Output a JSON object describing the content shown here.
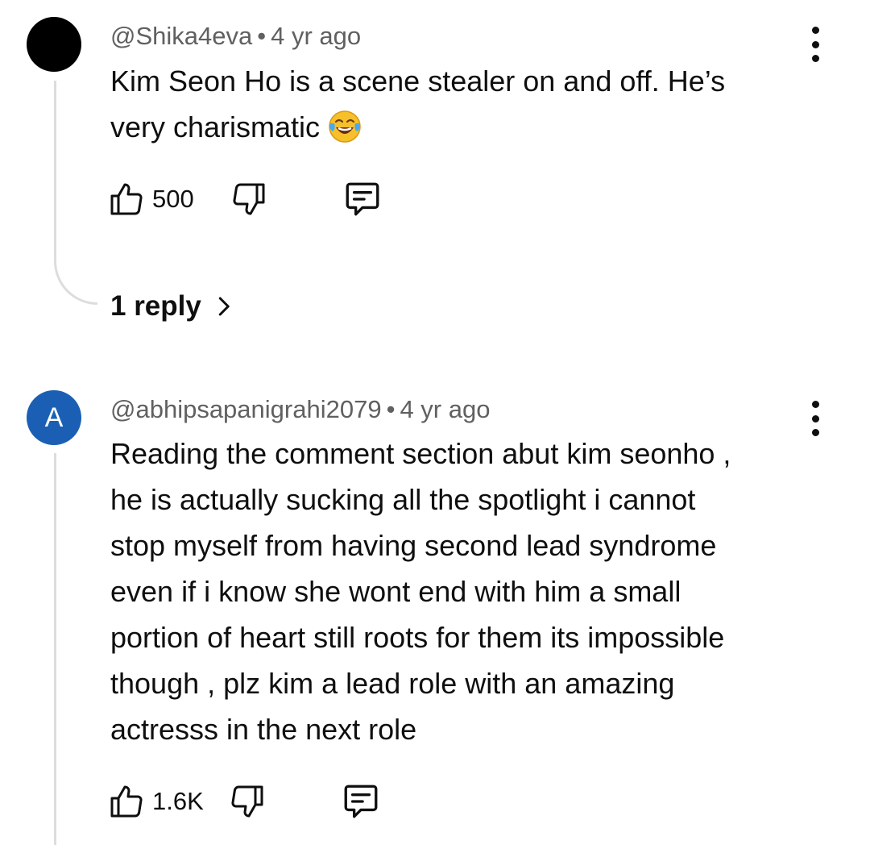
{
  "comments": [
    {
      "username": "@Shika4eva",
      "separator": "•",
      "time": "4 yr ago",
      "avatar_color": "#000000",
      "avatar_letter": "",
      "lines": [
        "Kim Seon Ho is a scene stealer on and off. He’s",
        "very charismatic"
      ],
      "emoji": "face-with-tears-of-joy",
      "likes": "500",
      "reply_link": "1 reply"
    },
    {
      "username": "@abhipsapanigrahi2079",
      "separator": "•",
      "time": "4 yr ago",
      "avatar_color": "#1a5fb4",
      "avatar_letter": "A",
      "lines": [
        "Reading the comment section abut kim seonho ,",
        "he is actually sucking all the spotlight i cannot",
        "stop myself from having second lead syndrome",
        "even if i know she wont end with him a small",
        "portion of heart still roots for them its impossible",
        "though , plz kim a lead role with an amazing",
        "actresss in the next role"
      ],
      "likes": "1.6K"
    }
  ],
  "icons": {
    "like": "thumbs-up-icon",
    "dislike": "thumbs-down-icon",
    "reply": "comment-icon",
    "more": "more-vert-icon",
    "expand": "chevron-right-icon"
  }
}
